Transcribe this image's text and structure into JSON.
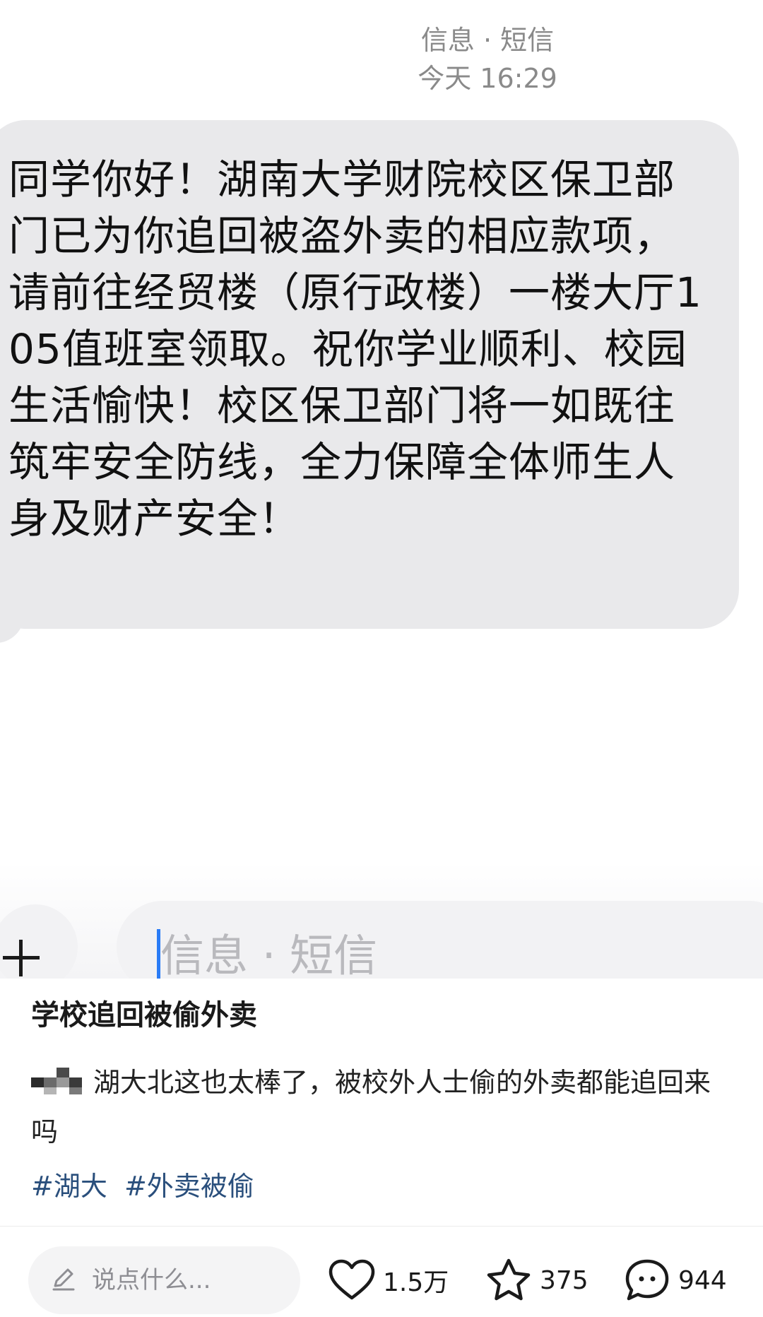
{
  "sms": {
    "header_title": "信息 · 短信",
    "header_time": "今天 16:29",
    "message": "同学你好！湖南大学财院校区保卫部门已为你追回被盗外卖的相应款项，请前往经贸楼（原行政楼）一楼大厅105值班室领取。祝你学业顺利、校园生活愉快！校区保卫部门将一如既往筑牢安全防线，全力保障全体师生人身及财产安全！",
    "input_placeholder": "信息 · 短信",
    "plus_icon": "plus-icon"
  },
  "post": {
    "title": "学校追回被偷外卖",
    "body": "湖大北这也太棒了，被校外人士偷的外卖都能追回来吗",
    "tags": [
      "#湖大",
      "#外卖被偷"
    ]
  },
  "bottom_bar": {
    "comment_placeholder": "说点什么...",
    "likes": "1.5万",
    "favorites": "375",
    "comments": "944"
  },
  "colors": {
    "bubble": "#e9e9eb",
    "tag": "#2a4f7c",
    "cursor": "#2a7cf6"
  }
}
